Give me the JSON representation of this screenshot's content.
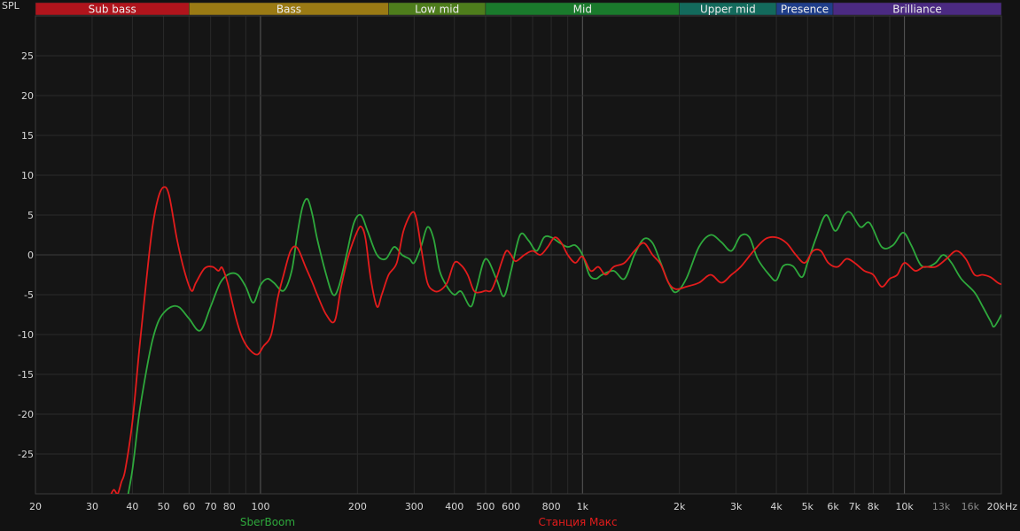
{
  "chart_data": {
    "type": "line",
    "ylabel": "SPL",
    "xscale": "log",
    "xlim": [
      20,
      20000
    ],
    "ylim": [
      -30,
      30
    ],
    "grid": true,
    "y_ticks": [
      25,
      20,
      15,
      10,
      5,
      0,
      -5,
      -10,
      -15,
      -20,
      -25
    ],
    "y_tick_labels": [
      "25",
      "20",
      "15",
      "10",
      "5",
      "0",
      "-5",
      "-10",
      "-15",
      "-20",
      "-25"
    ],
    "x_ticks": [
      {
        "value": 20,
        "label": "20",
        "major": false,
        "dim": false
      },
      {
        "value": 30,
        "label": "30",
        "major": false,
        "dim": false
      },
      {
        "value": 40,
        "label": "40",
        "major": false,
        "dim": false
      },
      {
        "value": 50,
        "label": "50",
        "major": false,
        "dim": false
      },
      {
        "value": 60,
        "label": "60",
        "major": false,
        "dim": false
      },
      {
        "value": 70,
        "label": "70",
        "major": false,
        "dim": false
      },
      {
        "value": 80,
        "label": "80",
        "major": false,
        "dim": false
      },
      {
        "value": 100,
        "label": "100",
        "major": true,
        "dim": false
      },
      {
        "value": 200,
        "label": "200",
        "major": false,
        "dim": false
      },
      {
        "value": 300,
        "label": "300",
        "major": false,
        "dim": false
      },
      {
        "value": 400,
        "label": "400",
        "major": false,
        "dim": false
      },
      {
        "value": 500,
        "label": "500",
        "major": false,
        "dim": false
      },
      {
        "value": 600,
        "label": "600",
        "major": false,
        "dim": false
      },
      {
        "value": 800,
        "label": "800",
        "major": false,
        "dim": false
      },
      {
        "value": 1000,
        "label": "1k",
        "major": true,
        "dim": false
      },
      {
        "value": 2000,
        "label": "2k",
        "major": false,
        "dim": false
      },
      {
        "value": 3000,
        "label": "3k",
        "major": false,
        "dim": false
      },
      {
        "value": 4000,
        "label": "4k",
        "major": false,
        "dim": false
      },
      {
        "value": 5000,
        "label": "5k",
        "major": false,
        "dim": false
      },
      {
        "value": 6000,
        "label": "6k",
        "major": false,
        "dim": false
      },
      {
        "value": 7000,
        "label": "7k",
        "major": false,
        "dim": false
      },
      {
        "value": 8000,
        "label": "8k",
        "major": false,
        "dim": false
      },
      {
        "value": 10000,
        "label": "10k",
        "major": true,
        "dim": false
      },
      {
        "value": 13000,
        "label": "13k",
        "major": false,
        "dim": true
      },
      {
        "value": 16000,
        "label": "16k",
        "major": false,
        "dim": true
      },
      {
        "value": 20000,
        "label": "20kHz",
        "major": false,
        "dim": false
      }
    ],
    "bands": [
      {
        "name": "Sub bass",
        "from": 20,
        "to": 60,
        "color": "#b0141c"
      },
      {
        "name": "Bass",
        "from": 60,
        "to": 250,
        "color": "#9a7a14"
      },
      {
        "name": "Low mid",
        "from": 250,
        "to": 500,
        "color": "#4e7d1c"
      },
      {
        "name": "Mid",
        "from": 500,
        "to": 2000,
        "color": "#1a7a2c"
      },
      {
        "name": "Upper mid",
        "from": 2000,
        "to": 4000,
        "color": "#136a5c"
      },
      {
        "name": "Presence",
        "from": 4000,
        "to": 6000,
        "color": "#1f3e8a"
      },
      {
        "name": "Brilliance",
        "from": 6000,
        "to": 20000,
        "color": "#4b2a82"
      }
    ],
    "series": [
      {
        "name": "SberBoom",
        "color": "#2ea83c",
        "points": [
          [
            38,
            -32
          ],
          [
            40,
            -27
          ],
          [
            42,
            -20
          ],
          [
            44,
            -15
          ],
          [
            46,
            -11
          ],
          [
            48,
            -8.5
          ],
          [
            50,
            -7.3
          ],
          [
            53,
            -6.5
          ],
          [
            56,
            -6.6
          ],
          [
            60,
            -8
          ],
          [
            65,
            -9.5
          ],
          [
            70,
            -6.5
          ],
          [
            75,
            -3.5
          ],
          [
            80,
            -2.4
          ],
          [
            85,
            -2.5
          ],
          [
            90,
            -4
          ],
          [
            95,
            -6
          ],
          [
            100,
            -3.8
          ],
          [
            105,
            -3
          ],
          [
            110,
            -3.5
          ],
          [
            118,
            -4.5
          ],
          [
            125,
            -2
          ],
          [
            130,
            2.5
          ],
          [
            135,
            6
          ],
          [
            140,
            7
          ],
          [
            145,
            5
          ],
          [
            150,
            2
          ],
          [
            160,
            -2.5
          ],
          [
            168,
            -5
          ],
          [
            175,
            -4
          ],
          [
            185,
            0
          ],
          [
            195,
            4
          ],
          [
            205,
            5
          ],
          [
            215,
            3
          ],
          [
            230,
            0
          ],
          [
            245,
            -0.5
          ],
          [
            260,
            1
          ],
          [
            275,
            0
          ],
          [
            290,
            -0.5
          ],
          [
            300,
            -1
          ],
          [
            315,
            1
          ],
          [
            330,
            3.5
          ],
          [
            345,
            2
          ],
          [
            360,
            -2
          ],
          [
            380,
            -4
          ],
          [
            400,
            -5
          ],
          [
            420,
            -4.6
          ],
          [
            450,
            -6.5
          ],
          [
            470,
            -4
          ],
          [
            500,
            -0.5
          ],
          [
            540,
            -3
          ],
          [
            570,
            -5.2
          ],
          [
            600,
            -2
          ],
          [
            640,
            2.5
          ],
          [
            680,
            1.8
          ],
          [
            720,
            0.5
          ],
          [
            760,
            2.2
          ],
          [
            800,
            2.2
          ],
          [
            850,
            1.5
          ],
          [
            900,
            1
          ],
          [
            950,
            1.2
          ],
          [
            1000,
            0
          ],
          [
            1050,
            -2.5
          ],
          [
            1100,
            -3
          ],
          [
            1150,
            -2.5
          ],
          [
            1250,
            -2
          ],
          [
            1350,
            -3
          ],
          [
            1450,
            0
          ],
          [
            1550,
            2
          ],
          [
            1650,
            1.5
          ],
          [
            1750,
            -1
          ],
          [
            1850,
            -3.5
          ],
          [
            1950,
            -4.7
          ],
          [
            2100,
            -3
          ],
          [
            2300,
            1
          ],
          [
            2500,
            2.5
          ],
          [
            2700,
            1.6
          ],
          [
            2900,
            0.5
          ],
          [
            3100,
            2.4
          ],
          [
            3300,
            2.2
          ],
          [
            3500,
            -0.5
          ],
          [
            3800,
            -2.5
          ],
          [
            4000,
            -3.2
          ],
          [
            4200,
            -1.4
          ],
          [
            4500,
            -1.4
          ],
          [
            4800,
            -2.8
          ],
          [
            5000,
            -1
          ],
          [
            5300,
            2
          ],
          [
            5700,
            5
          ],
          [
            6100,
            3
          ],
          [
            6500,
            5
          ],
          [
            6800,
            5.3
          ],
          [
            7300,
            3.5
          ],
          [
            7800,
            4
          ],
          [
            8500,
            1
          ],
          [
            9200,
            1.2
          ],
          [
            9900,
            2.8
          ],
          [
            10500,
            1.2
          ],
          [
            11200,
            -1.2
          ],
          [
            11800,
            -1.5
          ],
          [
            12500,
            -1
          ],
          [
            13200,
            0
          ],
          [
            14000,
            -1
          ],
          [
            15000,
            -3
          ],
          [
            16500,
            -4.7
          ],
          [
            17500,
            -6.5
          ],
          [
            18500,
            -8.3
          ],
          [
            19000,
            -9
          ],
          [
            20000,
            -7.5
          ]
        ]
      },
      {
        "name": "Станция Макс",
        "color": "#e31c1c",
        "points": [
          [
            33,
            -32
          ],
          [
            34,
            -30.5
          ],
          [
            35,
            -29.5
          ],
          [
            36,
            -30
          ],
          [
            37,
            -28.5
          ],
          [
            38,
            -27
          ],
          [
            40,
            -21
          ],
          [
            42,
            -12
          ],
          [
            44,
            -4
          ],
          [
            46,
            3
          ],
          [
            48,
            7
          ],
          [
            50,
            8.5
          ],
          [
            52,
            7.5
          ],
          [
            55,
            2
          ],
          [
            58,
            -2
          ],
          [
            61,
            -4.5
          ],
          [
            63,
            -3.5
          ],
          [
            67,
            -1.7
          ],
          [
            71,
            -1.5
          ],
          [
            74,
            -2
          ],
          [
            76,
            -1.6
          ],
          [
            79,
            -3.5
          ],
          [
            84,
            -8
          ],
          [
            88,
            -10.5
          ],
          [
            93,
            -12
          ],
          [
            98,
            -12.5
          ],
          [
            102,
            -11.5
          ],
          [
            108,
            -10
          ],
          [
            113,
            -5.5
          ],
          [
            118,
            -2.5
          ],
          [
            124,
            0.5
          ],
          [
            130,
            0.9
          ],
          [
            138,
            -1.5
          ],
          [
            145,
            -3.5
          ],
          [
            150,
            -5
          ],
          [
            160,
            -7.5
          ],
          [
            170,
            -8.3
          ],
          [
            178,
            -4
          ],
          [
            188,
            0
          ],
          [
            200,
            3
          ],
          [
            206,
            3.5
          ],
          [
            212,
            2
          ],
          [
            220,
            -3
          ],
          [
            230,
            -6.5
          ],
          [
            238,
            -5
          ],
          [
            250,
            -2.5
          ],
          [
            265,
            -1
          ],
          [
            278,
            3
          ],
          [
            295,
            5.3
          ],
          [
            305,
            4.5
          ],
          [
            318,
            0
          ],
          [
            330,
            -3.5
          ],
          [
            345,
            -4.5
          ],
          [
            360,
            -4.5
          ],
          [
            380,
            -3.5
          ],
          [
            400,
            -1
          ],
          [
            420,
            -1.3
          ],
          [
            440,
            -2.5
          ],
          [
            460,
            -4.5
          ],
          [
            480,
            -4.7
          ],
          [
            500,
            -4.5
          ],
          [
            520,
            -4.5
          ],
          [
            540,
            -3
          ],
          [
            560,
            -1
          ],
          [
            580,
            0.5
          ],
          [
            600,
            0
          ],
          [
            620,
            -0.8
          ],
          [
            660,
            0
          ],
          [
            700,
            0.5
          ],
          [
            740,
            0
          ],
          [
            780,
            1
          ],
          [
            820,
            2.2
          ],
          [
            860,
            1.5
          ],
          [
            900,
            0
          ],
          [
            950,
            -1
          ],
          [
            1000,
            -0.2
          ],
          [
            1060,
            -2
          ],
          [
            1120,
            -1.5
          ],
          [
            1180,
            -2.5
          ],
          [
            1250,
            -1.5
          ],
          [
            1350,
            -1
          ],
          [
            1450,
            0.5
          ],
          [
            1550,
            1.5
          ],
          [
            1650,
            0
          ],
          [
            1750,
            -1.2
          ],
          [
            1850,
            -3.5
          ],
          [
            1950,
            -4.3
          ],
          [
            2100,
            -4
          ],
          [
            2300,
            -3.5
          ],
          [
            2500,
            -2.5
          ],
          [
            2700,
            -3.5
          ],
          [
            2900,
            -2.5
          ],
          [
            3100,
            -1.5
          ],
          [
            3400,
            0.5
          ],
          [
            3700,
            2
          ],
          [
            4000,
            2.2
          ],
          [
            4300,
            1.5
          ],
          [
            4600,
            0
          ],
          [
            4900,
            -1
          ],
          [
            5200,
            0.5
          ],
          [
            5500,
            0.5
          ],
          [
            5800,
            -1
          ],
          [
            6200,
            -1.5
          ],
          [
            6600,
            -0.5
          ],
          [
            7000,
            -1
          ],
          [
            7500,
            -2
          ],
          [
            8000,
            -2.5
          ],
          [
            8500,
            -4
          ],
          [
            9000,
            -3
          ],
          [
            9500,
            -2.5
          ],
          [
            10000,
            -1
          ],
          [
            10800,
            -2
          ],
          [
            11500,
            -1.5
          ],
          [
            12500,
            -1.5
          ],
          [
            13500,
            -0.5
          ],
          [
            14500,
            0.5
          ],
          [
            15500,
            -0.5
          ],
          [
            16500,
            -2.5
          ],
          [
            17500,
            -2.5
          ],
          [
            18500,
            -2.8
          ],
          [
            19500,
            -3.5
          ],
          [
            20000,
            -3.7
          ]
        ]
      }
    ]
  }
}
